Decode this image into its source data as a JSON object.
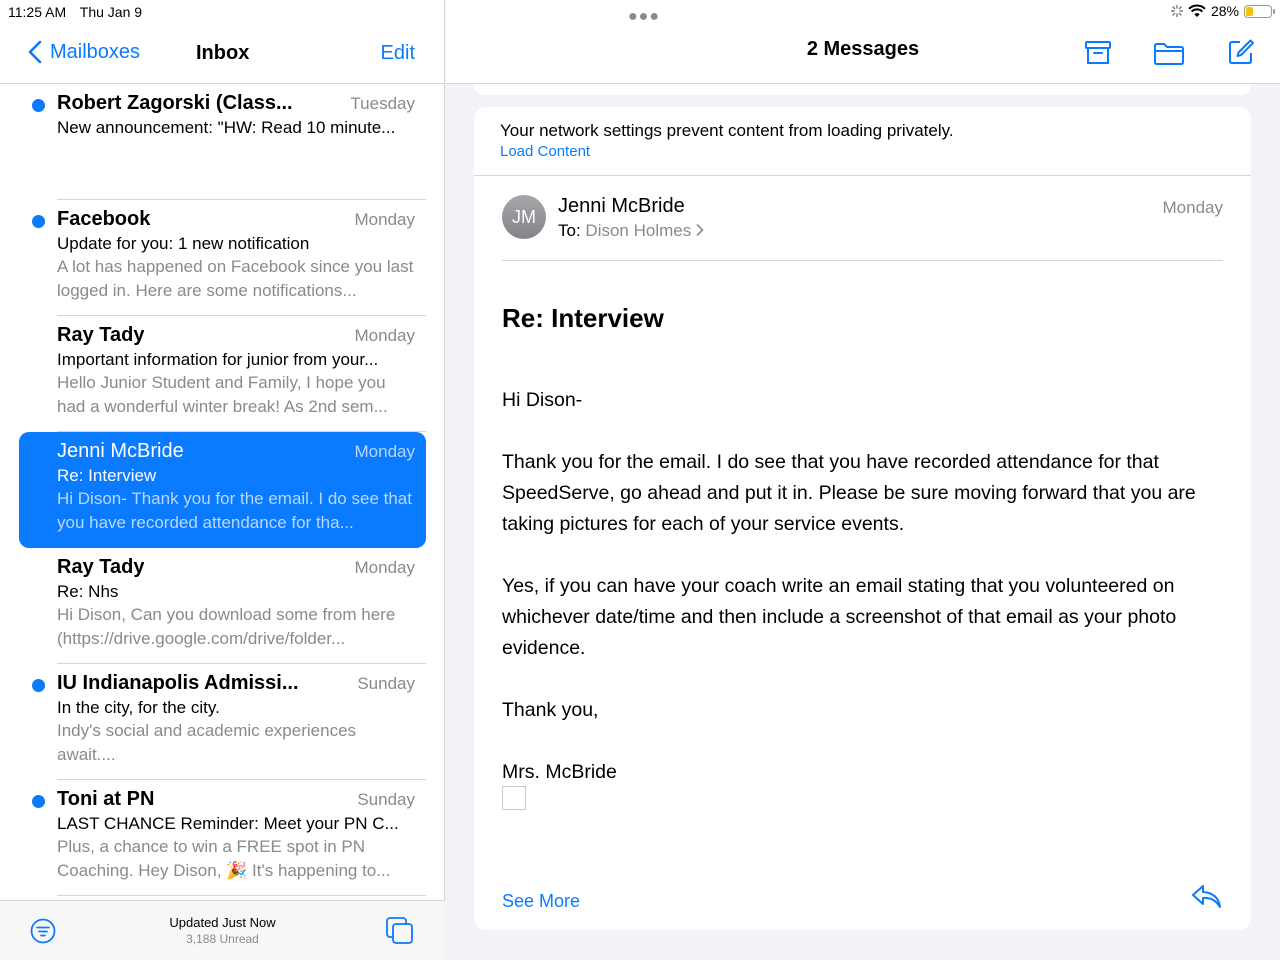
{
  "status_bar": {
    "time": "11:25 AM",
    "date": "Thu Jan 9",
    "battery": "28%",
    "battery_level": 0.28
  },
  "sidebar": {
    "back_label": "Mailboxes",
    "title": "Inbox",
    "edit_label": "Edit",
    "mails": [
      {
        "sender": "Robert Zagorski (Class...",
        "date": "Tuesday",
        "subject": "New announcement: \"HW: Read 10 minute...",
        "preview": "",
        "unread": true
      },
      {
        "sender": "Facebook",
        "date": "Monday",
        "subject": "Update for you: 1 new notification",
        "preview": "A lot has happened on Facebook since you last logged in. Here are some notifications...",
        "unread": true
      },
      {
        "sender": "Ray Tady",
        "date": "Monday",
        "subject": "Important information for junior from your...",
        "preview": "Hello Junior Student and Family, I hope you had a wonderful winter break! As 2nd sem...",
        "unread": false
      },
      {
        "sender": "Jenni McBride",
        "date": "Monday",
        "subject": "Re: Interview",
        "preview": "Hi Dison- Thank you for the email. I do see that you have recorded attendance for tha...",
        "unread": false,
        "selected": true
      },
      {
        "sender": "Ray Tady",
        "date": "Monday",
        "subject": "Re: Nhs",
        "preview": "Hi Dison, Can you download some from here (https://drive.google.com/drive/folder...",
        "unread": false
      },
      {
        "sender": "IU Indianapolis Admissi...",
        "date": "Sunday",
        "subject": "In the city, for the city.",
        "preview": "Indy's social and academic experiences await....",
        "unread": true
      },
      {
        "sender": "Toni at PN",
        "date": "Sunday",
        "subject": "LAST CHANCE Reminder: Meet your PN C...",
        "preview": "Plus, a chance to win a FREE spot in PN Coaching. Hey Dison, 🎉 It's happening to...",
        "unread": true
      }
    ],
    "toolbar": {
      "updated": "Updated Just Now",
      "unread": "3,188 Unread"
    }
  },
  "message_pane": {
    "title": "2 Messages",
    "banner": {
      "text": "Your network settings prevent content from loading privately.",
      "load_label": "Load Content"
    },
    "header": {
      "initials": "JM",
      "from": "Jenni McBride",
      "to_label": "To:",
      "to_name": "Dison Holmes",
      "date": "Monday"
    },
    "subject": "Re: Interview",
    "body": [
      "Hi Dison-",
      "Thank you for the email.  I do see that you have recorded attendance for that SpeedServe, go ahead and put it in.  Please be sure moving forward that you are taking pictures for each of your service events.",
      "Yes, if you can have your coach write an email stating that you volunteered on whichever date/time and then include a screenshot of that email as your photo evidence.",
      "Thank you,",
      "Mrs. McBride"
    ],
    "see_more": "See More"
  },
  "colors": {
    "accent": "#0a7aff",
    "secondary_text": "#8a8a8e",
    "battery": "#f5c400"
  }
}
